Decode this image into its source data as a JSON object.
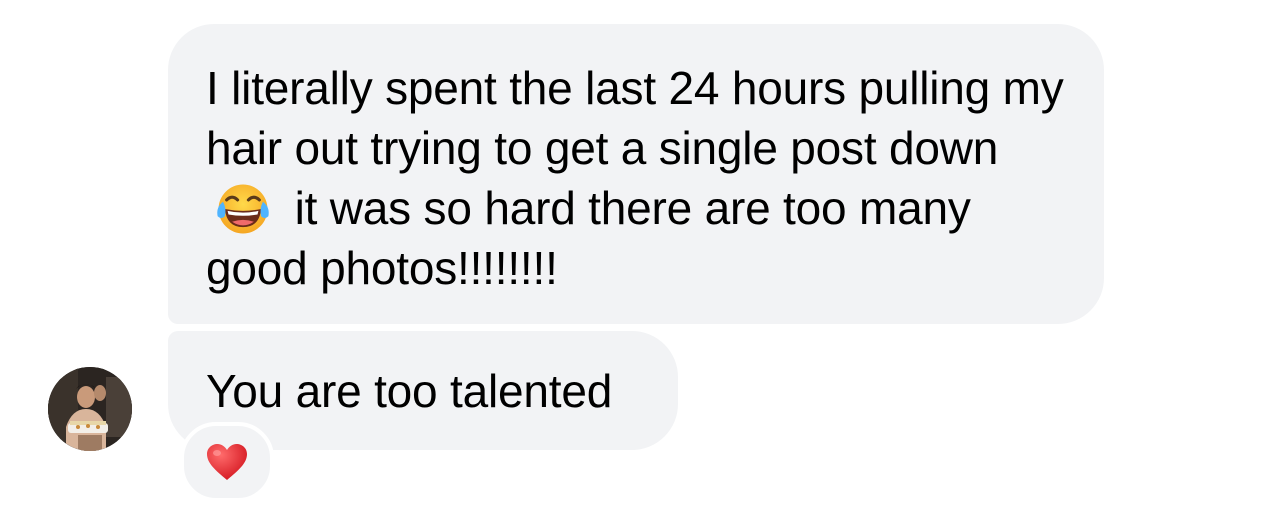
{
  "messages": [
    {
      "text_before_emoji": "I literally spent the last 24 hours pulling my hair out trying to get a single post down",
      "emoji": "face-with-tears-of-joy",
      "text_after_emoji": "it was so hard there are too many good photos!!!!!!!!"
    },
    {
      "text": "You are too talented",
      "reaction": "red-heart"
    }
  ],
  "colors": {
    "bubble_background": "#f2f3f5",
    "text": "#000000",
    "heart": "#e0202a"
  }
}
